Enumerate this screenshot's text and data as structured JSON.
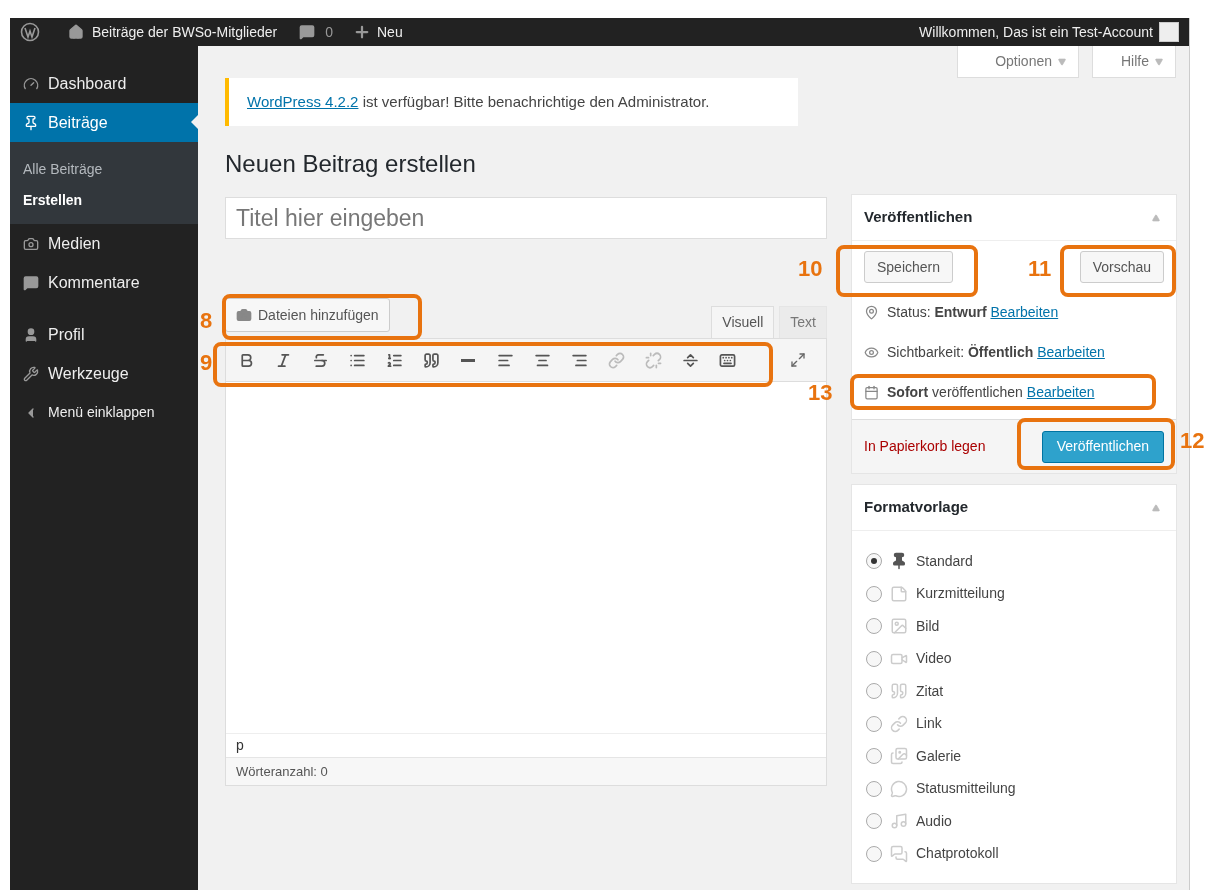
{
  "admin_bar": {
    "site_name": "Beiträge der BWSo-Mitglieder",
    "comments": "0",
    "new": "Neu",
    "greeting": "Willkommen, Das ist ein Test-Account"
  },
  "screen_tabs": [
    {
      "label": "Optionen"
    },
    {
      "label": "Hilfe"
    }
  ],
  "sidebar": {
    "items": [
      {
        "label": "Dashboard",
        "kind": "menu",
        "selected": false
      },
      {
        "label": "Beiträge",
        "kind": "menu",
        "selected": true,
        "children": [
          {
            "label": "Alle Beiträge",
            "selected": false
          },
          {
            "label": "Erstellen",
            "selected": true
          }
        ]
      },
      {
        "label": "Medien",
        "kind": "menu",
        "selected": false
      },
      {
        "label": "Kommentare",
        "kind": "menu",
        "selected": false
      },
      {
        "label": "Profil",
        "kind": "menu",
        "selected": false
      },
      {
        "label": "Werkzeuge",
        "kind": "menu",
        "selected": false
      },
      {
        "label": "Menü einklappen",
        "kind": "collapse",
        "selected": false
      }
    ]
  },
  "notice": {
    "link": "WordPress 4.2.2",
    "text": "ist verfügbar! Bitte benachrichtige den Administrator."
  },
  "page_title": "Neuen Beitrag erstellen",
  "title_field": {
    "placeholder": "Titel hier eingeben"
  },
  "media_button": "Dateien hinzufügen",
  "editor_tabs": [
    {
      "label": "Visuell",
      "selected": true
    },
    {
      "label": "Text",
      "selected": false
    }
  ],
  "toolbar": [
    {
      "disabled": false
    },
    {
      "disabled": false
    },
    {
      "disabled": false
    },
    {
      "disabled": false
    },
    {
      "disabled": false
    },
    {
      "disabled": false
    },
    {
      "disabled": false
    },
    {
      "disabled": false
    },
    {
      "disabled": false
    },
    {
      "disabled": false
    },
    {
      "disabled": true
    },
    {
      "disabled": true
    },
    {
      "disabled": false
    },
    {
      "disabled": false
    }
  ],
  "editor": {
    "path": "p",
    "word_count": "Wörteranzahl: 0"
  },
  "publish": {
    "title": "Veröffentlichen",
    "save": "Speichern",
    "preview": "Vorschau",
    "rows": [
      {
        "text": "Status: **Entwurf**",
        "link": "Bearbeiten"
      },
      {
        "text": "Sichtbarkeit: **Öffentlich**",
        "link": "Bearbeiten"
      },
      {
        "text": "**Sofort** veröffentlichen",
        "link": "Bearbeiten"
      }
    ],
    "trash": "In Papierkorb legen",
    "publish_button": "Veröffentlichen"
  },
  "format": {
    "title": "Formatvorlage",
    "options": [
      {
        "label": "Standard",
        "selected": true
      },
      {
        "label": "Kurzmitteilung",
        "selected": false
      },
      {
        "label": "Bild",
        "selected": false
      },
      {
        "label": "Video",
        "selected": false
      },
      {
        "label": "Zitat",
        "selected": false
      },
      {
        "label": "Link",
        "selected": false
      },
      {
        "label": "Galerie",
        "selected": false
      },
      {
        "label": "Statusmitteilung",
        "selected": false
      },
      {
        "label": "Audio",
        "selected": false
      },
      {
        "label": "Chatprotokoll",
        "selected": false
      }
    ]
  },
  "annotations": [
    {
      "label": "8"
    },
    {
      "label": "9"
    },
    {
      "label": "10"
    },
    {
      "label": "11"
    },
    {
      "label": "13"
    },
    {
      "label": "12"
    }
  ]
}
